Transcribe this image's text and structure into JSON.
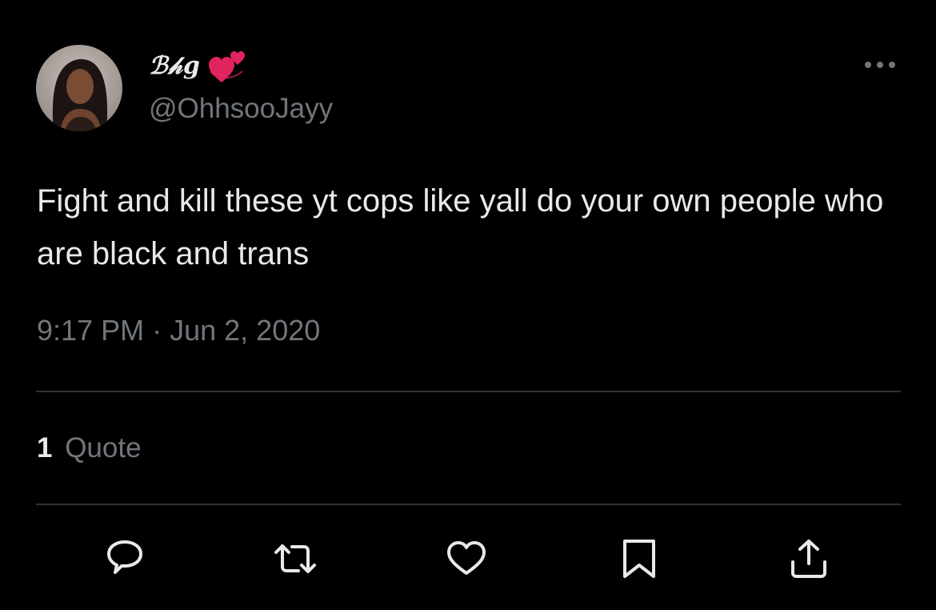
{
  "tweet": {
    "display_name": "ℬ𝒽g",
    "emoji": "revolving-hearts-icon",
    "handle": "@OhhsooJayy",
    "text": "Fight and kill these yt cops like yall do your own people who are black and trans",
    "time": "9:17 PM",
    "separator": "·",
    "date": "Jun 2, 2020",
    "quote_count": "1",
    "quote_label": "Quote"
  },
  "actions": {
    "icons": [
      "reply-icon",
      "retweet-icon",
      "like-icon",
      "bookmark-icon",
      "share-icon"
    ]
  },
  "colors": {
    "background": "#000000",
    "primary_text": "#e7e9ea",
    "secondary_text": "#71767b",
    "divider": "#2f3336",
    "heart": "#e0245e"
  }
}
